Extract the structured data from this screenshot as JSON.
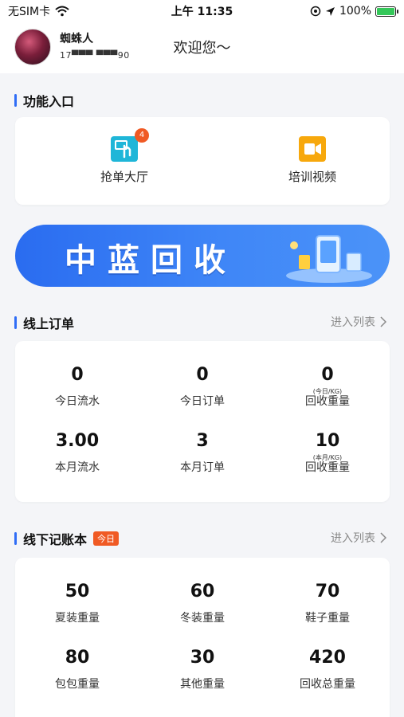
{
  "status_bar": {
    "carrier": "无SIM卡",
    "time": "上午 11:35",
    "battery": "100%"
  },
  "header": {
    "user_name": "蜘蛛人",
    "phone_masked": "17▀▀▀  ▀▀▀90",
    "greeting": "欢迎您～"
  },
  "function_section": {
    "title": "功能入口",
    "items": [
      {
        "label": "抢单大厅",
        "icon": "tap-hand-icon",
        "badge": "4"
      },
      {
        "label": "培训视频",
        "icon": "video-icon"
      }
    ]
  },
  "banner": {
    "text": "中蓝回收"
  },
  "online_orders": {
    "title": "线上订单",
    "enter_list": "进入列表",
    "stats": [
      {
        "value": "0",
        "label": "今日流水"
      },
      {
        "value": "0",
        "label": "今日订单"
      },
      {
        "value": "0",
        "label": "回收重量",
        "sub": "(今日/KG)"
      },
      {
        "value": "3.00",
        "label": "本月流水"
      },
      {
        "value": "3",
        "label": "本月订单"
      },
      {
        "value": "10",
        "label": "回收重量",
        "sub": "(本月/KG)"
      }
    ]
  },
  "offline_ledger": {
    "title": "线下记账本",
    "badge": "今日",
    "enter_list": "进入列表",
    "stats": [
      {
        "value": "50",
        "label": "夏装重量"
      },
      {
        "value": "60",
        "label": "冬装重量"
      },
      {
        "value": "70",
        "label": "鞋子重量"
      },
      {
        "value": "80",
        "label": "包包重量"
      },
      {
        "value": "30",
        "label": "其他重量"
      },
      {
        "value": "420",
        "label": "回收总重量"
      }
    ]
  },
  "colors": {
    "accent": "#2f6df6",
    "badge": "#f05a24",
    "background": "#f4f5f8"
  }
}
